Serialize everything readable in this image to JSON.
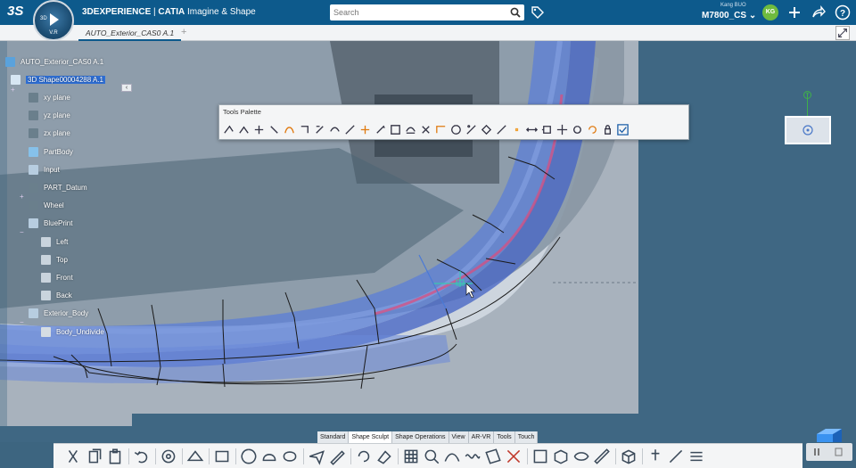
{
  "app": {
    "brand": "3DEXPERIENCE",
    "product": "CATIA",
    "role": "Imagine & Shape",
    "compass_version": "V.R",
    "compass_label": "3D"
  },
  "search": {
    "placeholder": "Search"
  },
  "user": {
    "name": "Kang BUO",
    "tenant": "M7800_CS",
    "initials": "KG"
  },
  "tab": {
    "title": "AUTO_Exterior_CAS0 A.1",
    "add": "+"
  },
  "tree": {
    "collapse": "‹",
    "items": [
      {
        "label": "AUTO_Exterior_CAS0 A.1",
        "icon": "product-icon",
        "color": "#5aa2dc"
      },
      {
        "label": "3D Shape00004288 A.1",
        "icon": "shape-icon",
        "color": "#d7e6f3",
        "selected": true
      },
      {
        "label": "xy plane",
        "icon": "plane-icon",
        "color": "#6a7f8c"
      },
      {
        "label": "yz plane",
        "icon": "plane-icon",
        "color": "#6a7f8c"
      },
      {
        "label": "zx plane",
        "icon": "plane-icon",
        "color": "#6a7f8c"
      },
      {
        "label": "PartBody",
        "icon": "body-icon",
        "color": "#86c1ea"
      },
      {
        "label": "Input",
        "icon": "geoset-icon",
        "color": "#b7cde0"
      },
      {
        "label": "PART_Datum",
        "icon": "plane-icon",
        "color": "#6a7f8c"
      },
      {
        "label": "Wheel",
        "icon": "plane-icon",
        "color": "#6a7f8c"
      },
      {
        "label": "BluePrint",
        "icon": "geoset-icon",
        "color": "#b7cde0"
      },
      {
        "label": "Left",
        "icon": "image-icon",
        "color": "#c9d4dd"
      },
      {
        "label": "Top",
        "icon": "image-icon",
        "color": "#c9d4dd"
      },
      {
        "label": "Front",
        "icon": "image-icon",
        "color": "#c9d4dd"
      },
      {
        "label": "Back",
        "icon": "image-icon",
        "color": "#c9d4dd"
      },
      {
        "label": "Exterior_Body",
        "icon": "geoset-icon",
        "color": "#b7cde0"
      },
      {
        "label": "Body_Undivide",
        "icon": "subdivision-icon",
        "color": "#d6dde3"
      }
    ]
  },
  "palette": {
    "title": "Tools Palette"
  },
  "action_tabs": [
    "Standard",
    "Shape Sculpt",
    "Shape Operations",
    "View",
    "AR-VR",
    "Tools",
    "Touch"
  ],
  "active_action_tab": "Shape Sculpt",
  "colors": {
    "brand_blue": "#0d5a8c",
    "selection": "#2e6fd6",
    "viewport": "#3f6783"
  }
}
